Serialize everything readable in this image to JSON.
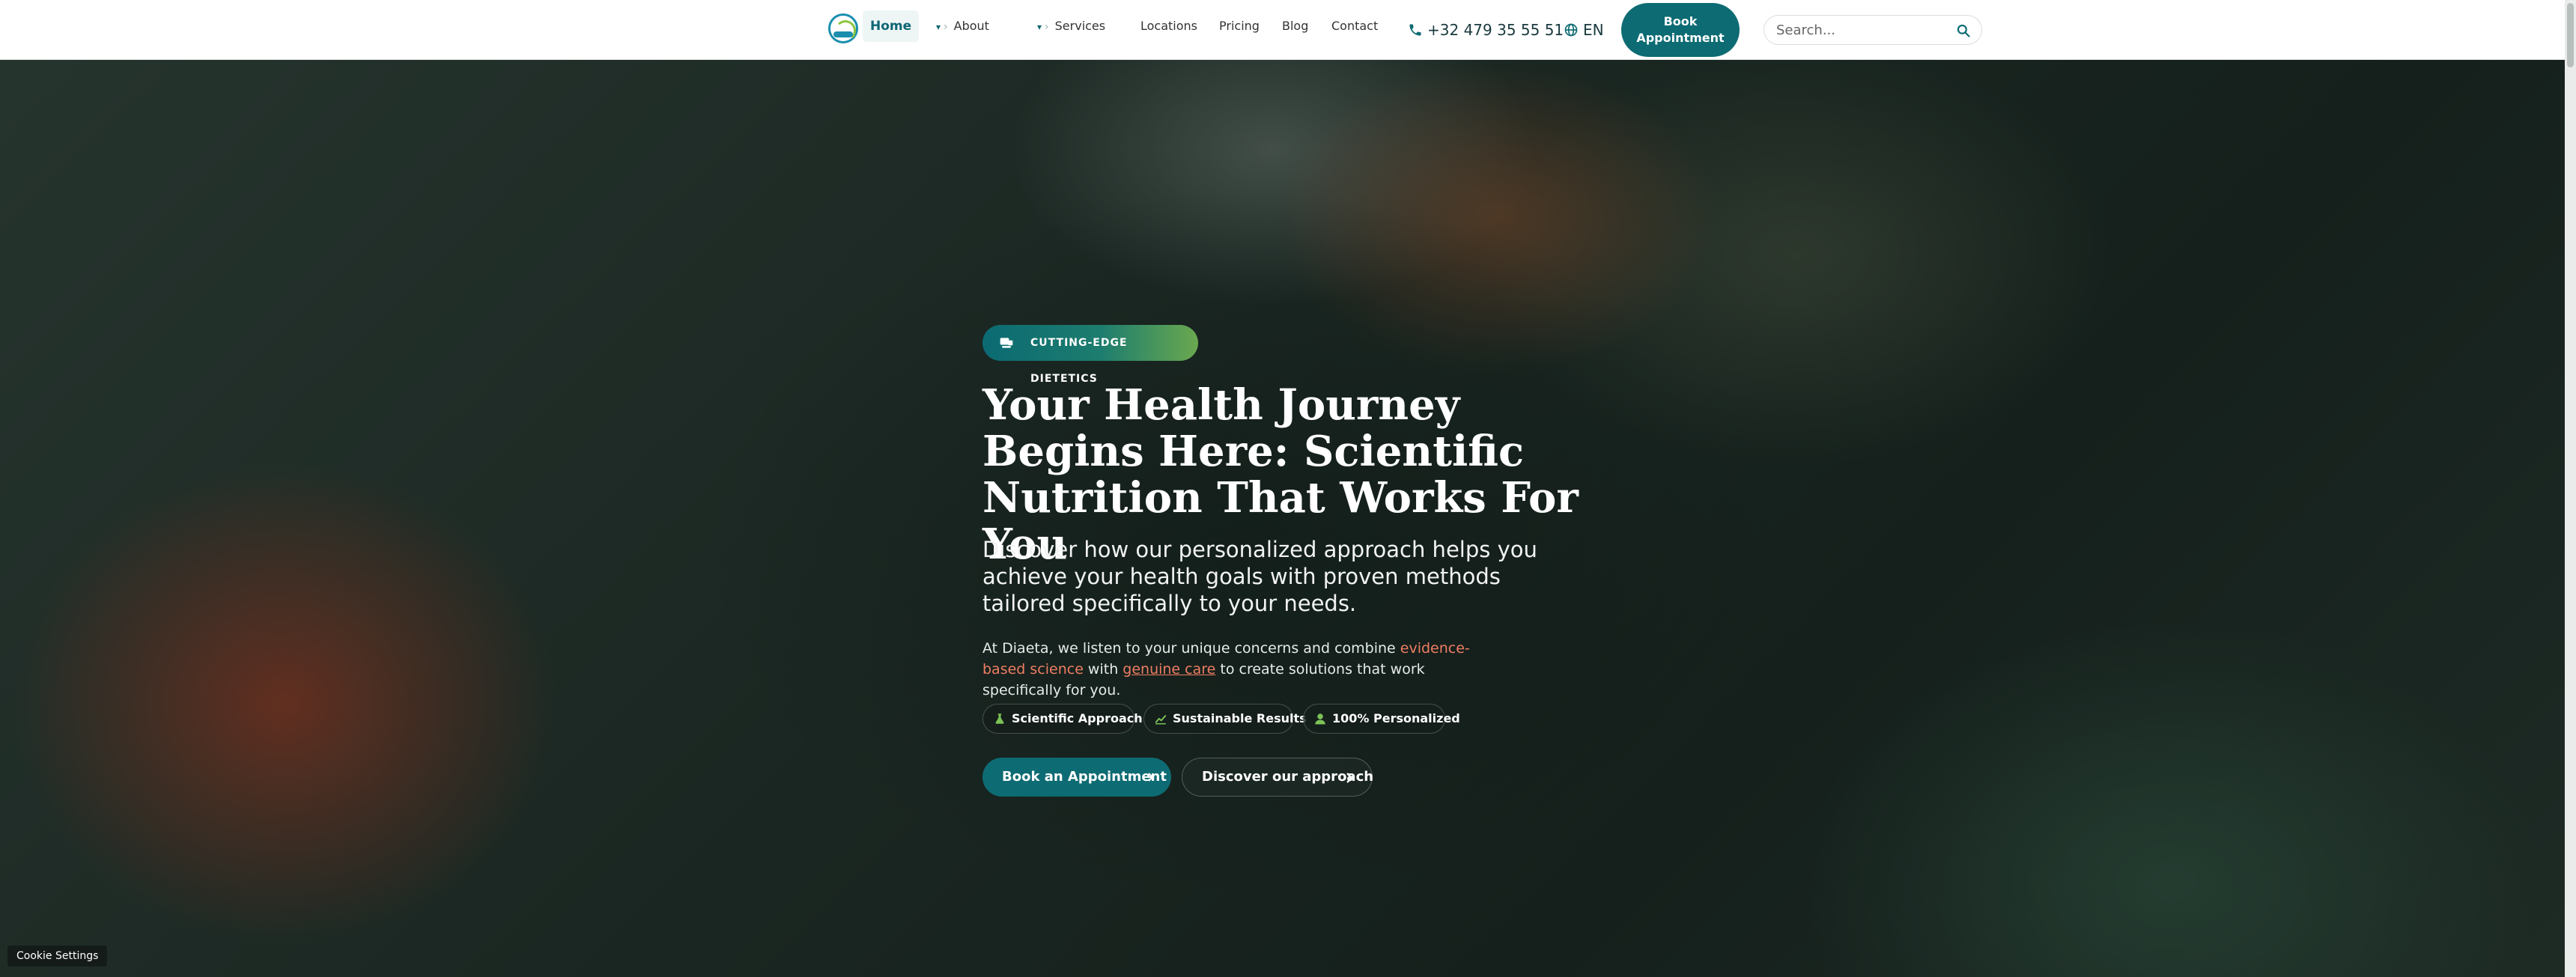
{
  "nav": {
    "home": "Home",
    "about": "About",
    "services": "Services",
    "locations": "Locations",
    "pricing": "Pricing",
    "blog": "Blog",
    "contact": "Contact",
    "dropdown_caret": "▾",
    "chevron": "›"
  },
  "header": {
    "phone": "+32 479 35 55 51",
    "language": "EN",
    "book_line1": "Book",
    "book_line2": "Appointment",
    "search_placeholder": "Search..."
  },
  "hero": {
    "badge": "CUTTING-EDGE DIETETICS",
    "title": "Your Health Journey Begins Here: Scientific Nutrition That Works For You",
    "lead": "Discover how our personalized approach helps you achieve your health goals with proven methods tailored specifically to your needs.",
    "body_part1": "At Diaeta, we listen to your unique concerns and combine ",
    "body_highlight1": "evidence-based science",
    "body_part2": " with ",
    "body_highlight2": "genuine care",
    "body_part3": " to create solutions that work specifically for you.",
    "features": [
      {
        "label": "Scientific Approach",
        "icon": "flask-icon"
      },
      {
        "label": "Sustainable Results",
        "icon": "chart-line-icon"
      },
      {
        "label": "100% Personalized",
        "icon": "user-icon"
      }
    ],
    "cta_primary": "Book an Appointment",
    "cta_secondary": "Discover our approach"
  },
  "cookie": {
    "label": "Cookie Settings"
  },
  "colors": {
    "brand_teal": "#0d6b73",
    "accent_green": "#6aa84f",
    "highlight_coral": "#ee7d63"
  }
}
